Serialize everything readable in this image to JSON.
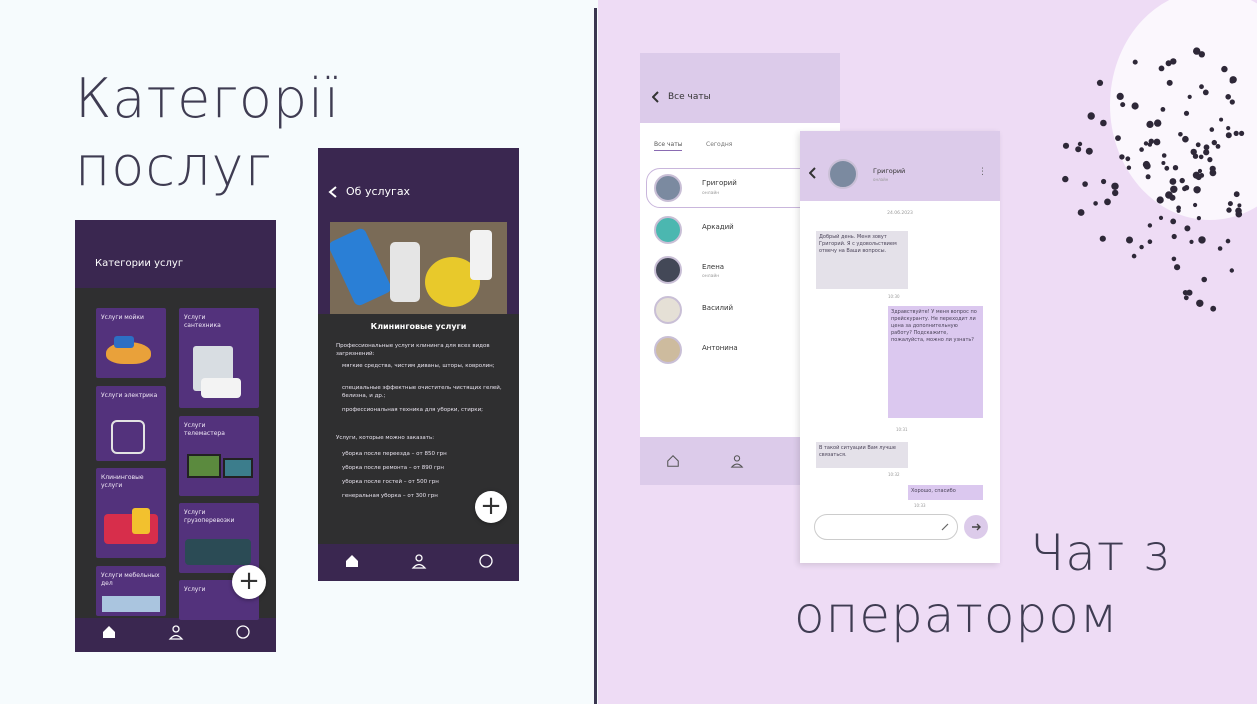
{
  "left": {
    "title_line1": "Категорії",
    "title_line2": "послуг"
  },
  "categories_phone": {
    "header": "Категории услуг",
    "tiles": [
      {
        "label": "Услуги мойки"
      },
      {
        "label": "Услуги сантехника"
      },
      {
        "label": "Услуги электрика"
      },
      {
        "label": "Услуги телемастера"
      },
      {
        "label": "Клининговые услуги"
      },
      {
        "label": "Услуги грузоперевозки"
      },
      {
        "label": "Услуги мебельных дел"
      },
      {
        "label": "Услуги"
      }
    ],
    "fab": "+"
  },
  "service_phone": {
    "back_label": "Об услугах",
    "service_title": "Клининговые услуги",
    "intro": "Профессиональные услуги клининга для всех видов загрязнений:",
    "bullets": [
      "мягкие средства, чистим диваны, шторы, ковролин;",
      "специальные эффектные очиститель чистящих гелей, белизна, и др.;",
      "профессиональная техника для уборки, стирки;"
    ],
    "prices_intro": "Услуги, которые можно заказать:",
    "prices": [
      "уборка после переезда – от 850 грн",
      "уборка после ремонта – от 890 грн",
      "уборка после гостей – от 500 грн",
      "генеральная уборка – от 300 грн"
    ],
    "fab": "+"
  },
  "chats_phone": {
    "back_label": "Все чаты",
    "tabs": [
      "Все чаты",
      "Сегодня"
    ],
    "contacts": [
      {
        "name": "Григорий",
        "status": "онлайн"
      },
      {
        "name": "Аркадий",
        "status": ""
      },
      {
        "name": "Елена",
        "status": "онлайн"
      },
      {
        "name": "Василий",
        "status": ""
      },
      {
        "name": "Антонина",
        "status": ""
      }
    ]
  },
  "chat_window": {
    "contact_name": "Григорий",
    "contact_status": "онлайн",
    "date": "24.06.2023",
    "messages": [
      {
        "from": "operator",
        "text": "Добрый день. Меня зовут Григорий. Я с удовольствием отвечу на Ваши вопросы.",
        "time": "10:30"
      },
      {
        "from": "user",
        "text": "Здравствуйте! У меня вопрос по прейскуранту. Не переходит ли цена за дополнительную работу? Подскажите, пожалуйста, можно ли узнать?",
        "time": "10:31"
      },
      {
        "from": "operator",
        "text": "В такой ситуации Вам лучше связаться.",
        "time": "10:32"
      },
      {
        "from": "user",
        "text": "Хорошо, спасибо",
        "time": "10:33"
      }
    ]
  },
  "right": {
    "title_line1": "Чат з",
    "title_line2": "оператором"
  },
  "colors": {
    "phone_bg": "#3a2750",
    "tile_bg": "#53327c",
    "right_bg": "#eedcf5",
    "left_bg": "#f6fbfd",
    "title_text": "#3f3c52",
    "chat_header": "#dcc9ec",
    "bubble_operator": "#e4e1e9",
    "bubble_user": "#dbc8ef"
  },
  "icons": [
    "home-icon",
    "user-icon",
    "chat-icon",
    "back-icon",
    "plus-icon",
    "send-icon",
    "paperclip-icon",
    "menu-dots-icon"
  ]
}
